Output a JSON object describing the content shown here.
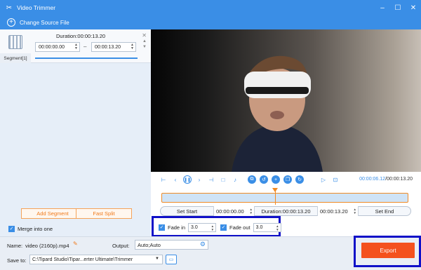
{
  "window": {
    "title": "Video Trimmer",
    "controls": [
      "–",
      "☐",
      "✕"
    ]
  },
  "source": {
    "label": "Change Source File"
  },
  "segment": {
    "tab_label": "Segment[1]",
    "duration": "Duration:00:00:13.20",
    "start": "00:00:00.00",
    "end": "00:00:13.20"
  },
  "left_actions": {
    "add_segment": "Add Segment",
    "fast_split": "Fast Split",
    "merge_label": "Merge into one",
    "merge_checked": true
  },
  "player": {
    "current_time": "00:00:06.12",
    "total_time": "/00:00:13.20",
    "playhead_fraction": 0.46
  },
  "edit": {
    "set_start": "Set Start",
    "start_time": "00:00:00.00",
    "duration_label": "Duration:00:00:13.20",
    "end_time": "00:00:13.20",
    "set_end": "Set End"
  },
  "fade": {
    "fade_in_label": "Fade in",
    "fade_in_value": "3.0",
    "fade_in_checked": true,
    "fade_out_label": "Fade out",
    "fade_out_value": "3.0",
    "fade_out_checked": true
  },
  "bottom": {
    "name_label": "Name:",
    "name_value": "video (2160p).mp4",
    "output_label": "Output:",
    "output_value": "Auto;Auto",
    "saveto_label": "Save to:",
    "saveto_value": "C:\\Tipard Studio\\Tipar...erter Ultimate\\Trimmer",
    "export_label": "Export"
  },
  "colors": {
    "accent": "#3a8ee6",
    "export": "#f4511e",
    "highlight_box": "#1010c8",
    "orange": "#f07a1b"
  }
}
